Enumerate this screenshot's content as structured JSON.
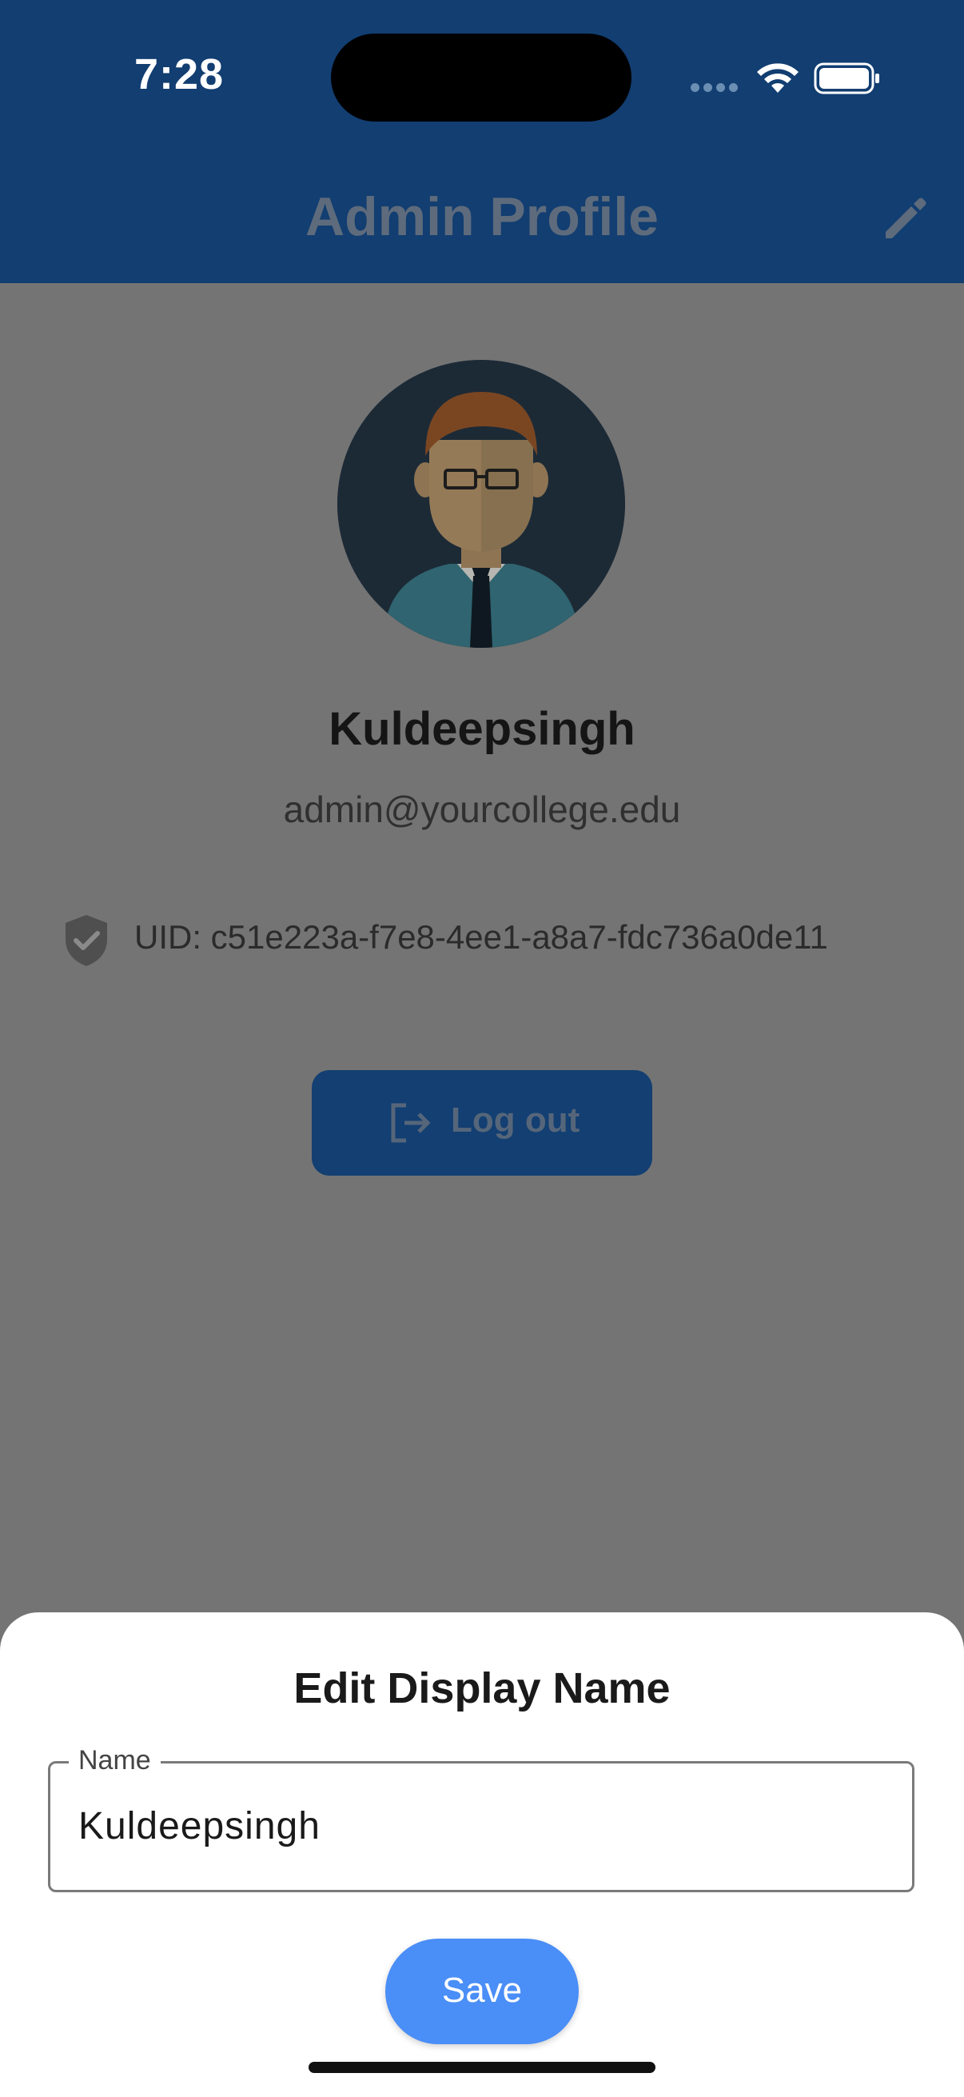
{
  "status_bar": {
    "time": "7:28"
  },
  "app_bar": {
    "title": "Admin Profile",
    "edit_icon": "pencil-icon"
  },
  "profile": {
    "avatar_icon": "avatar-illustration",
    "name": "Kuldeepsingh",
    "email": "admin@yourcollege.edu",
    "uid_icon": "verified-shield-icon",
    "uid": "UID: c51e223a-f7e8-4ee1-a8a7-fdc736a0de11",
    "logout_icon": "logout-icon",
    "logout_label": "Log out"
  },
  "sheet": {
    "title": "Edit Display Name",
    "field_label": "Name",
    "field_value": "Kuldeepsingh",
    "save_label": "Save"
  },
  "colors": {
    "app_bar": "#123e71",
    "overlay_body": "#747474",
    "save_button": "#4a8ef7",
    "sheet_background": "#ffffff"
  }
}
